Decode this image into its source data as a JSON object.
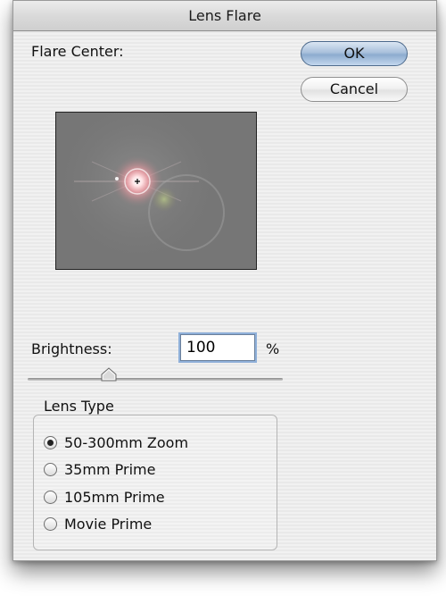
{
  "dialog": {
    "title": "Lens Flare",
    "flare_center_label": "Flare Center:",
    "ok_label": "OK",
    "cancel_label": "Cancel"
  },
  "brightness": {
    "label": "Brightness:",
    "value": "100",
    "unit": "%",
    "slider_value_percent": 100
  },
  "lens_type": {
    "label": "Lens Type",
    "options": [
      {
        "label": "50-300mm Zoom",
        "checked": true
      },
      {
        "label": "35mm Prime",
        "checked": false
      },
      {
        "label": "105mm Prime",
        "checked": false
      },
      {
        "label": "Movie Prime",
        "checked": false
      }
    ]
  },
  "colors": {
    "default_button": "#a9c0dc",
    "preview_background": "#777777",
    "flare_glow": "#f2a0a8"
  }
}
